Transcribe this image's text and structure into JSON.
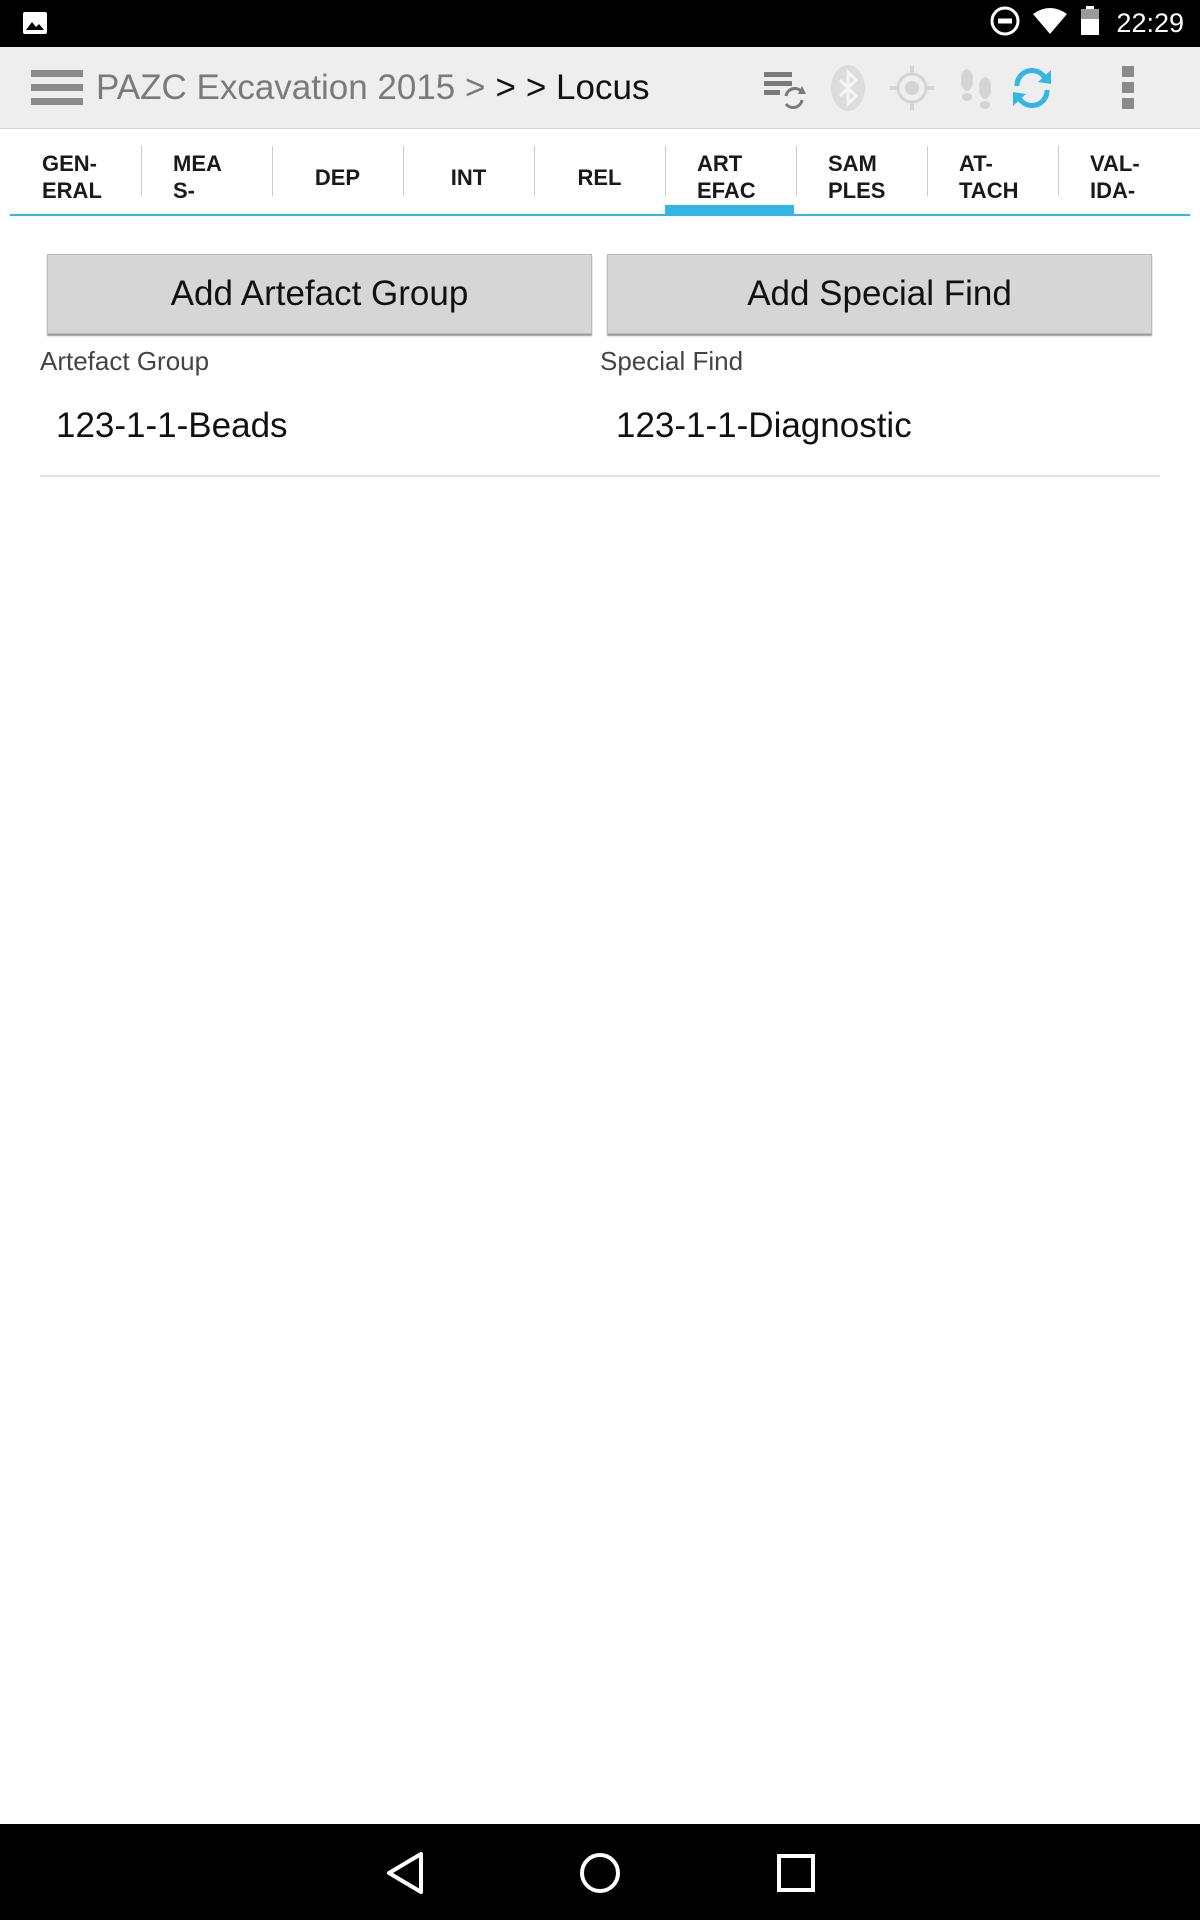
{
  "status_bar": {
    "time": "22:29",
    "icons": [
      "image-icon",
      "do-not-disturb-icon",
      "wifi-icon",
      "battery-icon"
    ]
  },
  "app_bar": {
    "project": "PAZC Excavation 2015 >",
    "crumb_2": ">",
    "crumb_3": "> Locus",
    "icons": [
      "sync-settings-icon",
      "bluetooth-icon",
      "gps-icon",
      "tracking-icon",
      "sync-icon",
      "overflow-menu-icon"
    ],
    "accent": "#33b5e5"
  },
  "tabs": [
    {
      "line1": "GEN-",
      "line2": "ERAL"
    },
    {
      "line1": "MEA",
      "line2": "S-"
    },
    {
      "line1": "DEP",
      "line2": ""
    },
    {
      "line1": "INT",
      "line2": ""
    },
    {
      "line1": "REL",
      "line2": ""
    },
    {
      "line1": "ART",
      "line2": "EFAC",
      "selected": true
    },
    {
      "line1": "SAM",
      "line2": "PLES"
    },
    {
      "line1": "AT-",
      "line2": "TACH"
    },
    {
      "line1": "VAL-",
      "line2": "IDA-"
    }
  ],
  "buttons": {
    "add_artefact_group": "Add Artefact Group",
    "add_special_find": "Add Special Find"
  },
  "columns": {
    "artefact_group": {
      "label": "Artefact Group",
      "value": "123-1-1-Beads"
    },
    "special_find": {
      "label": "Special Find",
      "value": "123-1-1-Diagnostic"
    }
  },
  "nav_bar": {
    "icons": [
      "back-icon",
      "home-icon",
      "recents-icon"
    ]
  }
}
